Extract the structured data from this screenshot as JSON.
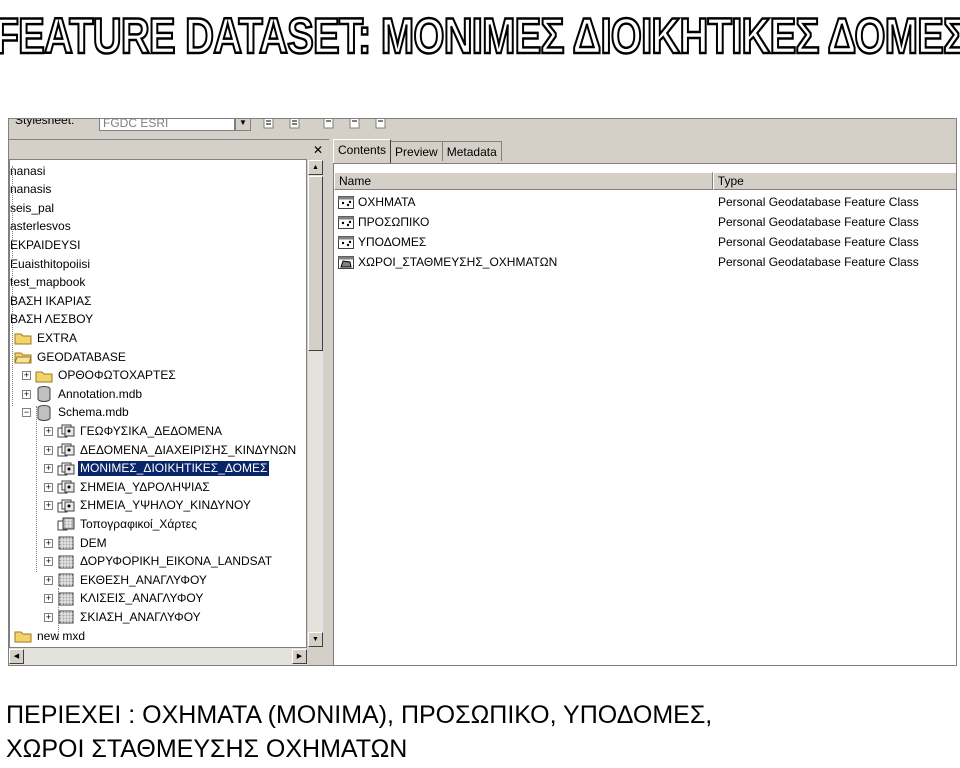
{
  "banner": {
    "title": "FEATURE DATASET: ΜΟΝΙΜΕΣ ΔΙΟΙΚΗΤΙΚΕΣ ΔΟΜΕΣ"
  },
  "toolbar": {
    "stylesheet_label": "Stylesheet:",
    "stylesheet_value": "FGDC ESRI"
  },
  "left_panel": {
    "close_glyph": "✕",
    "tree": [
      {
        "label": "nanasi",
        "indent": 0,
        "icon": "none",
        "expander": "none"
      },
      {
        "label": "nanasis",
        "indent": 0,
        "icon": "none",
        "expander": "none"
      },
      {
        "label": "seis_pal",
        "indent": 0,
        "icon": "none",
        "expander": "none"
      },
      {
        "label": "asterlesvos",
        "indent": 0,
        "icon": "none",
        "expander": "none"
      },
      {
        "label": "EKPAIDEYSI",
        "indent": 0,
        "icon": "none",
        "expander": "none"
      },
      {
        "label": "Euaisthitopoiisi",
        "indent": 0,
        "icon": "none",
        "expander": "none"
      },
      {
        "label": "test_mapbook",
        "indent": 0,
        "icon": "none",
        "expander": "none"
      },
      {
        "label": "ΒΑΣΗ ΙΚΑΡΙΑΣ",
        "indent": 0,
        "icon": "none",
        "expander": "none"
      },
      {
        "label": "ΒΑΣΗ ΛΕΣΒΟΥ",
        "indent": 0,
        "icon": "none",
        "expander": "none"
      },
      {
        "label": "EXTRA",
        "indent": 1,
        "icon": "folder",
        "expander": "none"
      },
      {
        "label": "GEODATABASE",
        "indent": 1,
        "icon": "folder-open",
        "expander": "none"
      },
      {
        "label": "ΟΡΘΟΦΩΤΟΧΑΡΤΕΣ",
        "indent": 2,
        "icon": "folder",
        "expander": "plus"
      },
      {
        "label": "Annotation.mdb",
        "indent": 2,
        "icon": "database",
        "expander": "plus"
      },
      {
        "label": "Schema.mdb",
        "indent": 2,
        "icon": "database",
        "expander": "minus"
      },
      {
        "label": "ΓΕΩΦΥΣΙΚΑ_ΔΕΔΟΜΕΝΑ",
        "indent": 3,
        "icon": "feature-dataset",
        "expander": "plus"
      },
      {
        "label": "ΔΕΔΟΜΕΝΑ_ΔΙΑΧΕΙΡΙΣΗΣ_ΚΙΝΔΥΝΩΝ",
        "indent": 3,
        "icon": "feature-dataset",
        "expander": "plus"
      },
      {
        "label": "ΜΟΝΙΜΕΣ_ΔΙΟΙΚΗΤΙΚΕΣ_ΔΟΜΕΣ",
        "indent": 3,
        "icon": "feature-dataset",
        "expander": "plus",
        "selected": true
      },
      {
        "label": "ΣΗΜΕΙΑ_ΥΔΡΟΛΗΨΙΑΣ",
        "indent": 3,
        "icon": "feature-dataset",
        "expander": "plus"
      },
      {
        "label": "ΣΗΜΕΙΑ_ΥΨΗΛΟΥ_ΚΙΝΔΥΝΟΥ",
        "indent": 3,
        "icon": "feature-dataset",
        "expander": "plus"
      },
      {
        "label": "Τοπογραφικοί_Χάρτες",
        "indent": 3,
        "icon": "raster-catalog",
        "expander": "none"
      },
      {
        "label": "DEM",
        "indent": 3,
        "icon": "raster",
        "expander": "plus"
      },
      {
        "label": "ΔΟΡΥΦΟΡΙΚΗ_ΕΙΚΟΝΑ_LANDSAT",
        "indent": 3,
        "icon": "raster",
        "expander": "plus"
      },
      {
        "label": "ΕΚΘΕΣΗ_ΑΝΑΓΛΥΦΟΥ",
        "indent": 3,
        "icon": "raster",
        "expander": "plus"
      },
      {
        "label": "ΚΛΙΣΕΙΣ_ΑΝΑΓΛΥΦΟΥ",
        "indent": 3,
        "icon": "raster",
        "expander": "plus"
      },
      {
        "label": "ΣΚΙΑΣΗ_ΑΝΑΓΛΥΦΟΥ",
        "indent": 3,
        "icon": "raster",
        "expander": "plus"
      },
      {
        "label": "new mxd",
        "indent": 1,
        "icon": "folder",
        "expander": "none"
      }
    ]
  },
  "right_panel": {
    "tabs": [
      {
        "label": "Contents",
        "active": true
      },
      {
        "label": "Preview",
        "active": false
      },
      {
        "label": "Metadata",
        "active": false
      }
    ],
    "columns": {
      "name": "Name",
      "type": "Type"
    },
    "rows": [
      {
        "name": "ΟΧΗΜΑΤΑ",
        "type": "Personal Geodatabase Feature Class",
        "icon": "point-feature-class"
      },
      {
        "name": "ΠΡΟΣΩΠΙΚΟ",
        "type": "Personal Geodatabase Feature Class",
        "icon": "point-feature-class"
      },
      {
        "name": "ΥΠΟΔΟΜΕΣ",
        "type": "Personal Geodatabase Feature Class",
        "icon": "point-feature-class"
      },
      {
        "name": "ΧΩΡΟΙ_ΣΤΑΘΜΕΥΣΗΣ_ΟΧΗΜΑΤΩΝ",
        "type": "Personal Geodatabase Feature Class",
        "icon": "polygon-feature-class"
      }
    ]
  },
  "caption": {
    "line1": "ΠΕΡΙΕΧΕΙ : ΟΧΗΜΑΤΑ (ΜΟΝΙΜΑ), ΠΡΟΣΩΠΙΚΟ, ΥΠΟΔΟΜΕΣ,",
    "line2": "ΧΩΡΟΙ ΣΤΑΘΜΕΥΣΗΣ ΟΧΗΜΑΤΩΝ"
  },
  "colors": {
    "selection": "#0a246a",
    "chrome": "#d4d0c8",
    "folder": "#f2d46b"
  }
}
